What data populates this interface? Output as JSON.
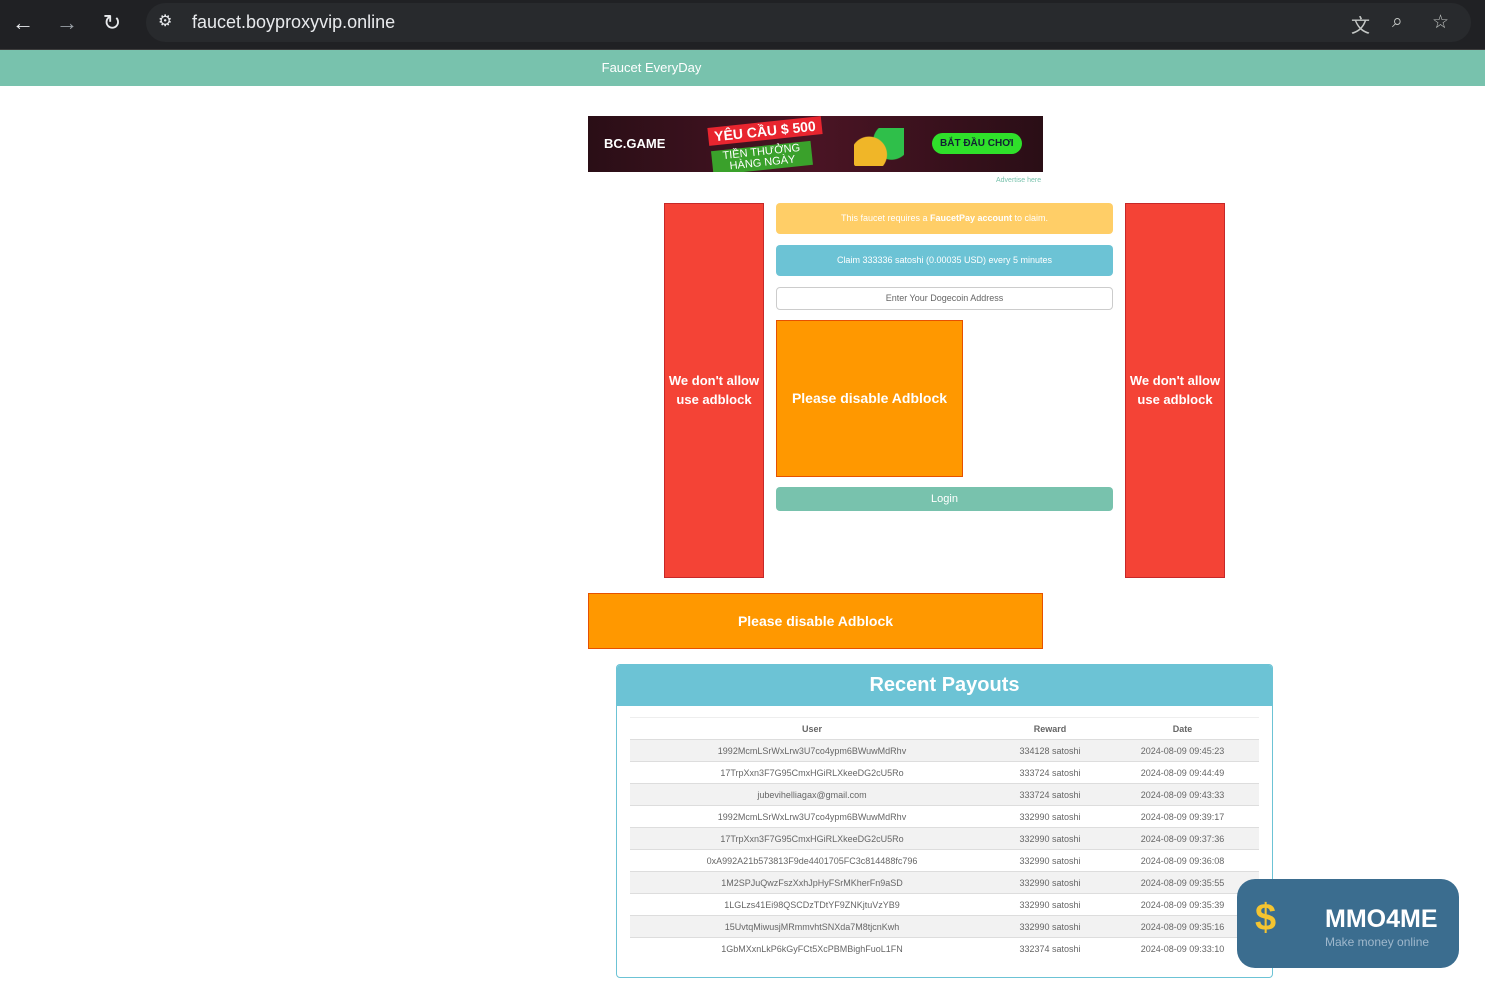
{
  "browser": {
    "url": "faucet.boyproxyvip.online"
  },
  "header": {
    "title": "Faucet EveryDay"
  },
  "ad": {
    "brand": "BC.GAME",
    "headline": "YÊU CẦU $ 500",
    "sub": "TIỀN THƯỞNG HÀNG NGÀY",
    "cta": "BẮT ĐẦU CHƠI",
    "advertise": "Advertise here"
  },
  "side": {
    "left": "We don't allow use adblock",
    "right": "We don't allow use adblock"
  },
  "form": {
    "notice_pre": "This faucet requires a ",
    "notice_bold": "FaucetPay account",
    "notice_post": " to claim.",
    "claim": "Claim 333336 satoshi (0.00035 USD) every 5 minutes",
    "address_placeholder": "Enter Your Dogecoin Address",
    "adblock": "Please disable Adblock",
    "login": "Login"
  },
  "bottom_adblock": "Please disable Adblock",
  "payouts": {
    "title": "Recent Payouts",
    "headers": [
      "User",
      "Reward",
      "Date"
    ],
    "rows": [
      [
        "1992McmLSrWxLrw3U7co4ypm6BWuwMdRhv",
        "334128 satoshi",
        "2024-08-09 09:45:23"
      ],
      [
        "17TrpXxn3F7G95CmxHGiRLXkeeDG2cU5Ro",
        "333724 satoshi",
        "2024-08-09 09:44:49"
      ],
      [
        "jubevihelliagax@gmail.com",
        "333724 satoshi",
        "2024-08-09 09:43:33"
      ],
      [
        "1992McmLSrWxLrw3U7co4ypm6BWuwMdRhv",
        "332990 satoshi",
        "2024-08-09 09:39:17"
      ],
      [
        "17TrpXxn3F7G95CmxHGiRLXkeeDG2cU5Ro",
        "332990 satoshi",
        "2024-08-09 09:37:36"
      ],
      [
        "0xA992A21b573813F9de4401705FC3c814488fc796",
        "332990 satoshi",
        "2024-08-09 09:36:08"
      ],
      [
        "1M2SPJuQwzFszXxhJpHyFSrMKherFn9aSD",
        "332990 satoshi",
        "2024-08-09 09:35:55"
      ],
      [
        "1LGLzs41Ei98QSCDzTDtYF9ZNKjtuVzYB9",
        "332990 satoshi",
        "2024-08-09 09:35:39"
      ],
      [
        "15UvtqMiwusjMRmmvhtSNXda7M8tjcnKwh",
        "332990 satoshi",
        "2024-08-09 09:35:16"
      ],
      [
        "1GbMXxnLkP6kGyFCt5XcPBMBighFuoL1FN",
        "332374 satoshi",
        "2024-08-09 09:33:10"
      ]
    ]
  },
  "watermark": {
    "name": "MMO4ME",
    "tagline": "Make money online"
  }
}
